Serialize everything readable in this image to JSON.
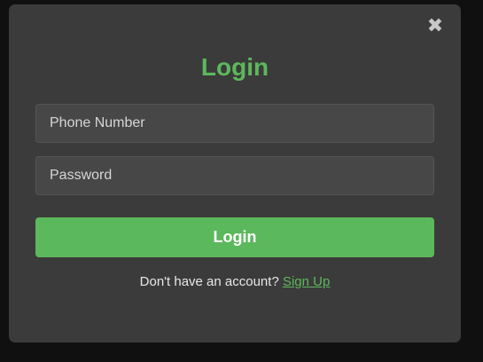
{
  "modal": {
    "close_icon": "close-icon",
    "close_glyph": "✖",
    "title": "Login",
    "phone_placeholder": "Phone Number",
    "password_placeholder": "Password",
    "login_button": "Login",
    "signup_prompt": "Don't have an account?",
    "signup_link": "Sign Up"
  },
  "colors": {
    "accent": "#5cb85c",
    "modal_bg": "#3b3b3b",
    "input_bg": "#474747",
    "backdrop": "#101010"
  }
}
